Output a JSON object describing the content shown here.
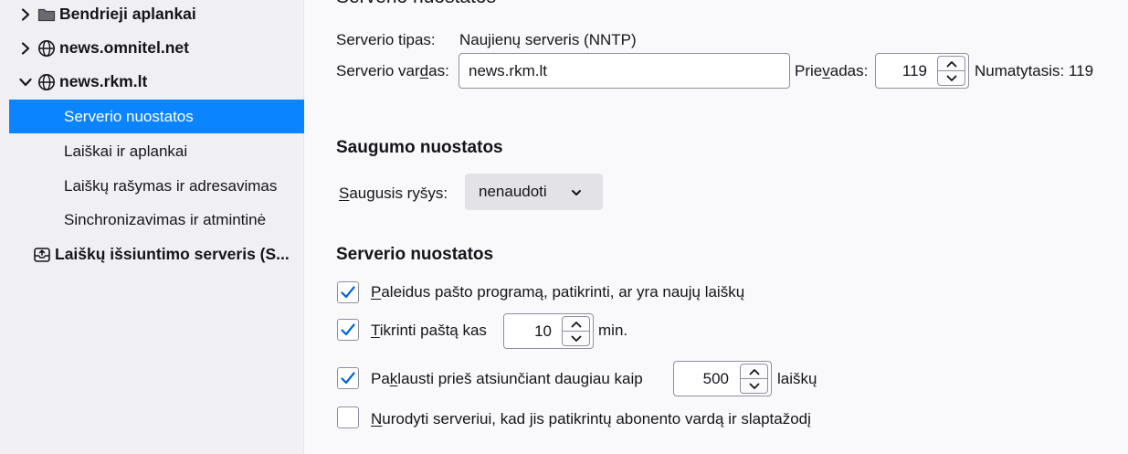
{
  "sidebar": {
    "accounts": [
      {
        "label": "Bendrieji aplankai",
        "icon": "folder-icon",
        "expanded": false
      },
      {
        "label": "news.omnitel.net",
        "icon": "globe-icon",
        "expanded": false
      },
      {
        "label": "news.rkm.lt",
        "icon": "globe-icon",
        "expanded": true
      }
    ],
    "children": [
      {
        "label": "Serverio nuostatos",
        "selected": true
      },
      {
        "label": "Laiškai ir aplankai",
        "selected": false
      },
      {
        "label": "Laiškų rašymas ir adresavimas",
        "selected": false
      },
      {
        "label": "Sinchronizavimas ir atmintinė",
        "selected": false
      }
    ],
    "outgoing": {
      "label": "Laiškų išsiuntimo serveris (S...",
      "icon": "outbox-icon"
    }
  },
  "main": {
    "page_title": "Serverio nuostatos",
    "server_type_label": "Serverio tipas:",
    "server_type_value": "Naujienų serveris (NNTP)",
    "server_name": {
      "label_pre": "Serverio var",
      "label_key": "d",
      "label_post": "as:",
      "value": "news.rkm.lt"
    },
    "port": {
      "label_pre": "Prie",
      "label_key": "v",
      "label_post": "adas:",
      "value": "119",
      "default_text": "Numatytasis: 119"
    },
    "security_heading": "Saugumo nuostatos",
    "secure_connection": {
      "label_key": "S",
      "label_rest": "augusis ryšys:",
      "value": "nenaudoti"
    },
    "server_settings_heading": "Serverio nuostatos",
    "options": [
      {
        "checked": true,
        "label_key": "P",
        "label_rest": "aleidus pašto programą, patikrinti, ar yra naujų laiškų"
      },
      {
        "checked": true,
        "label_key": "T",
        "label_rest": "ikrinti paštą kas",
        "value": "10",
        "suffix": "min."
      },
      {
        "checked": true,
        "label_pre": "Pa",
        "label_key": "k",
        "label_rest": "lausti prieš atsiunčiant daugiau kaip",
        "value": "500",
        "suffix": "laiškų"
      },
      {
        "checked": false,
        "label_key": "N",
        "label_rest": "urodyti serveriui, kad jis patikrintų abonento vardą ir slaptažodį"
      }
    ]
  },
  "colors": {
    "selection": "#0a84ff",
    "checkmark": "#0060df",
    "sidebar_bg": "#f0f0f4",
    "main_bg": "#f9f9fb"
  }
}
